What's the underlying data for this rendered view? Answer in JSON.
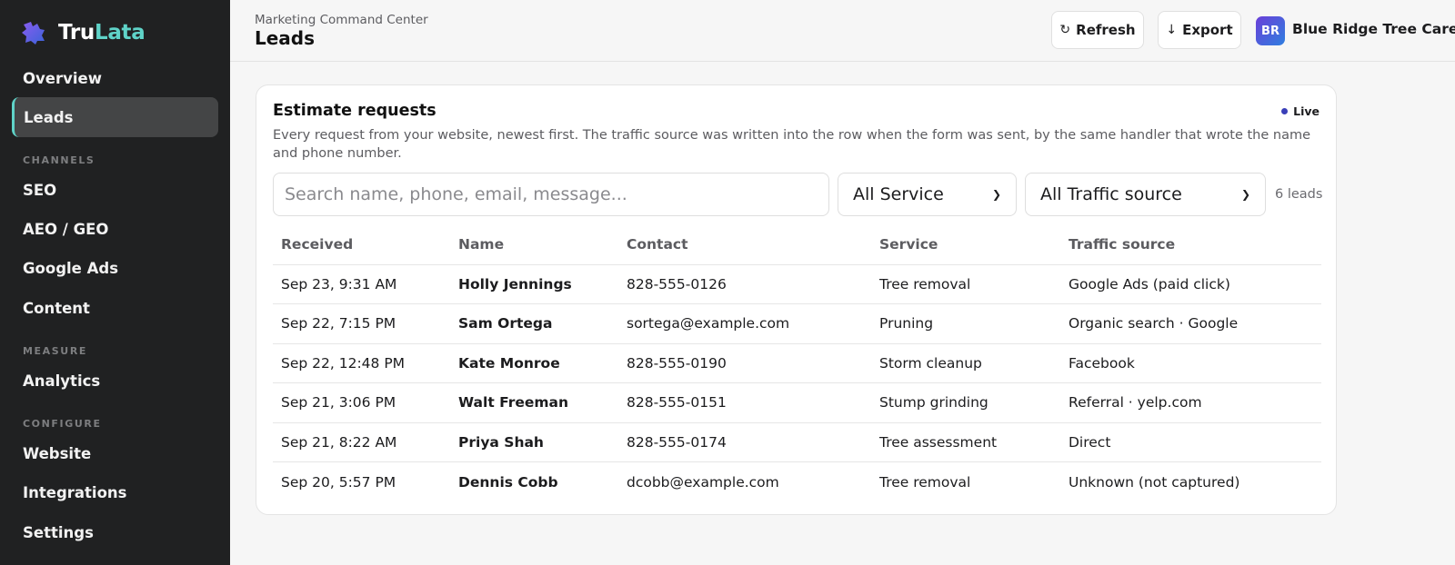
{
  "brand": {
    "part1": "Tru",
    "part2": "Lata"
  },
  "nav": {
    "overview": "Overview",
    "leads": "Leads",
    "section_channels": "CHANNELS",
    "seo": "SEO",
    "aeo": "AEO / GEO",
    "google_ads": "Google Ads",
    "content": "Content",
    "section_measure": "MEASURE",
    "analytics": "Analytics",
    "section_configure": "CONFIGURE",
    "website": "Website",
    "integrations": "Integrations",
    "settings": "Settings"
  },
  "header": {
    "breadcrumb": "Marketing Command Center",
    "title": "Leads",
    "refresh_label": "Refresh",
    "export_label": "Export",
    "avatar_initials": "BR",
    "org_name": "Blue Ridge Tree Care"
  },
  "card": {
    "title": "Estimate requests",
    "live_label": "Live",
    "description": "Every request from your website, newest first. The traffic source was written into the row when the form was sent, by the same handler that wrote the name and phone number."
  },
  "filters": {
    "search_placeholder": "Search name, phone, email, message...",
    "service_selected": "All Service",
    "source_selected": "All Traffic source",
    "count": "6 leads"
  },
  "table": {
    "columns": [
      "Received",
      "Name",
      "Contact",
      "Service",
      "Traffic source"
    ],
    "rows": [
      [
        "Sep 23, 9:31 AM",
        "Holly Jennings",
        "828-555-0126",
        "Tree removal",
        "Google Ads (paid click)"
      ],
      [
        "Sep 22, 7:15 PM",
        "Sam Ortega",
        "sortega@example.com",
        "Pruning",
        "Organic search · Google"
      ],
      [
        "Sep 22, 12:48 PM",
        "Kate Monroe",
        "828-555-0190",
        "Storm cleanup",
        "Facebook"
      ],
      [
        "Sep 21, 3:06 PM",
        "Walt Freeman",
        "828-555-0151",
        "Stump grinding",
        "Referral · yelp.com"
      ],
      [
        "Sep 21, 8:22 AM",
        "Priya Shah",
        "828-555-0174",
        "Tree assessment",
        "Direct"
      ],
      [
        "Sep 20, 5:57 PM",
        "Dennis Cobb",
        "dcobb@example.com",
        "Tree removal",
        "Unknown (not captured)"
      ]
    ]
  },
  "colors": {
    "accent": "#5fd3c8",
    "sidebar_bg": "#202122",
    "live_dot": "#3a3fb8"
  },
  "icons": {
    "logo": "puzzle-logo-icon",
    "refresh": "refresh-icon",
    "export": "download-arrow-icon",
    "select": "chevron-down-icon"
  }
}
